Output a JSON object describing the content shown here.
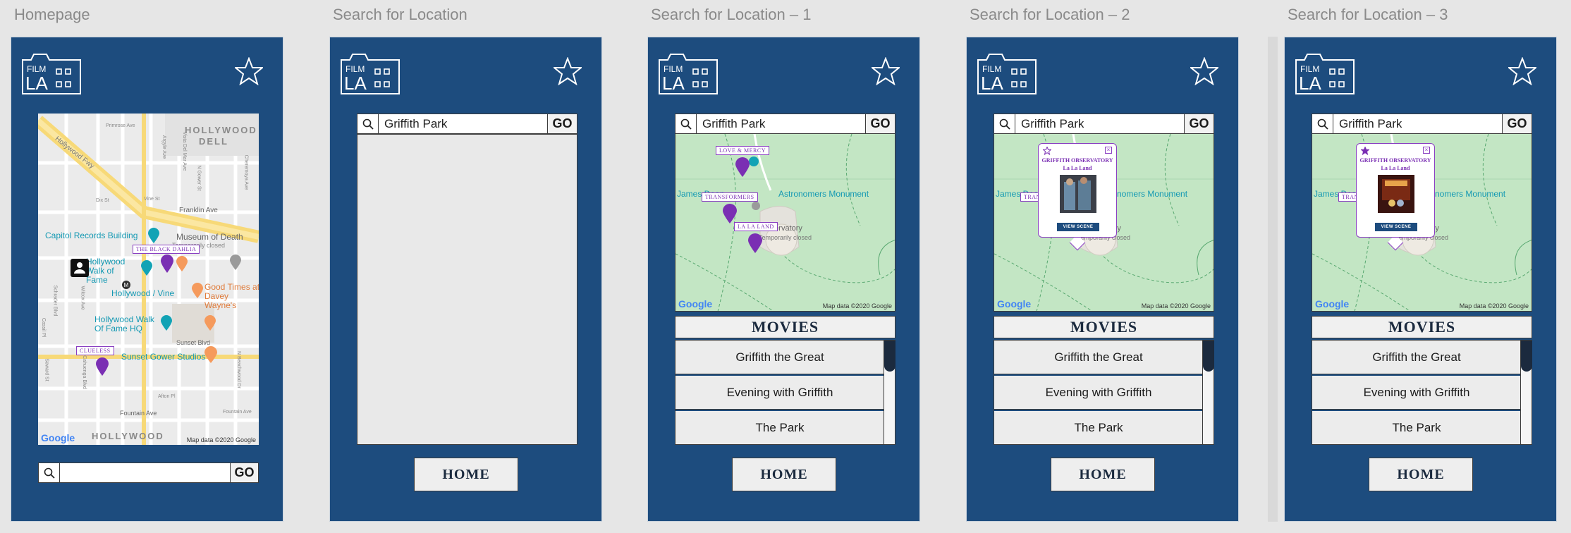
{
  "artboards": {
    "homepage": {
      "title": "Homepage"
    },
    "search": {
      "title": "Search for Location"
    },
    "search1": {
      "title": "Search for Location – 1"
    },
    "search2": {
      "title": "Search for Location – 2"
    },
    "search3": {
      "title": "Search for Location – 3"
    }
  },
  "logo": {
    "top_text": "FILM",
    "big_text": "LA"
  },
  "search": {
    "query": "Griffith Park",
    "go_label": "GO",
    "empty_value": ""
  },
  "home_label": "HOME",
  "movies": {
    "heading": "MOVIES",
    "items": [
      "Griffith the Great",
      "Evening with Griffith",
      "The Park"
    ]
  },
  "home_map": {
    "streets": [
      "HOLLYWOOD",
      "DELL",
      "Hollywood Fwy",
      "Franklin Ave",
      "Sunset Blvd",
      "Fountain Ave",
      "HOLLYWOOD",
      "Primrose Ave",
      "Vine St",
      "Argyle Ave",
      "Vista Del Mar Ave",
      "N Gower St",
      "Cheremoya Ave",
      "Dix St",
      "Schrader Blvd",
      "Wilcox Ave",
      "Cassil Pl",
      "Seward St",
      "N Cahuenga Blvd",
      "Afton Pl",
      "N Beachwood Dr",
      "Fountain Ave"
    ],
    "pois": [
      "Capitol Records Building",
      "Museum of Death",
      "Temporarily closed",
      "Hollywood Walk of Fame",
      "Hollywood / Vine",
      "Good Times at Davey Wayne's",
      "Hollywood Walk Of Fame HQ",
      "Sunset Gower Studios"
    ],
    "markers": [
      "THE BLACK DAHLIA",
      "CLUELESS"
    ],
    "google": "Google",
    "attribution": "Map data ©2020 Google"
  },
  "park_map": {
    "labels": [
      "James Dean",
      "Astronomers Monument",
      "Observatory",
      "Temporarily closed"
    ],
    "markers": [
      "LOVE & MERCY",
      "TRANSFORMERS",
      "LA LA LAND"
    ],
    "google": "Google",
    "attribution": "Map data ©2020 Google"
  },
  "popup": {
    "title_line1": "GRIFFITH OBSERVATORY",
    "title_line2": "La La Land",
    "button": "VIEW SCENE",
    "close": "×"
  },
  "colors": {
    "panel_blue": "#1d4c7e",
    "marker_purple": "#7a2fb3",
    "poi_teal": "#12a3b5",
    "poi_orange": "#f59a5c",
    "map_green": "#c3e6c4"
  }
}
